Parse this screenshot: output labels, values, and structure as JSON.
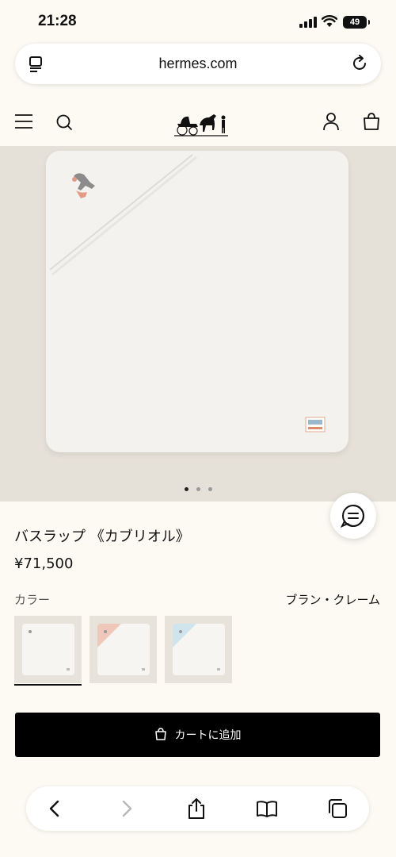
{
  "status_bar": {
    "time": "21:28",
    "battery": "49"
  },
  "browser": {
    "url": "hermes.com"
  },
  "header": {
    "menu_icon": "menu-icon",
    "search_icon": "search-icon",
    "logo": "hermes-carriage-logo",
    "account_icon": "user-icon",
    "bag_icon": "shopping-bag-icon"
  },
  "carousel": {
    "total_images": 3,
    "current_image": 1
  },
  "product": {
    "title": "バスラップ 《カブリオル》",
    "price": "¥71,500",
    "color_label": "カラー",
    "color_value": "ブラン・クレーム",
    "swatches": [
      {
        "accent": "#ffffff",
        "selected": true
      },
      {
        "accent": "#f0c8bb",
        "selected": false
      },
      {
        "accent": "#cfe4ec",
        "selected": false
      }
    ],
    "add_to_cart_label": "カートに追加"
  },
  "colors": {
    "background": "#fcfaf3",
    "hero_background": "#e6e1d8",
    "button": "#000000"
  }
}
